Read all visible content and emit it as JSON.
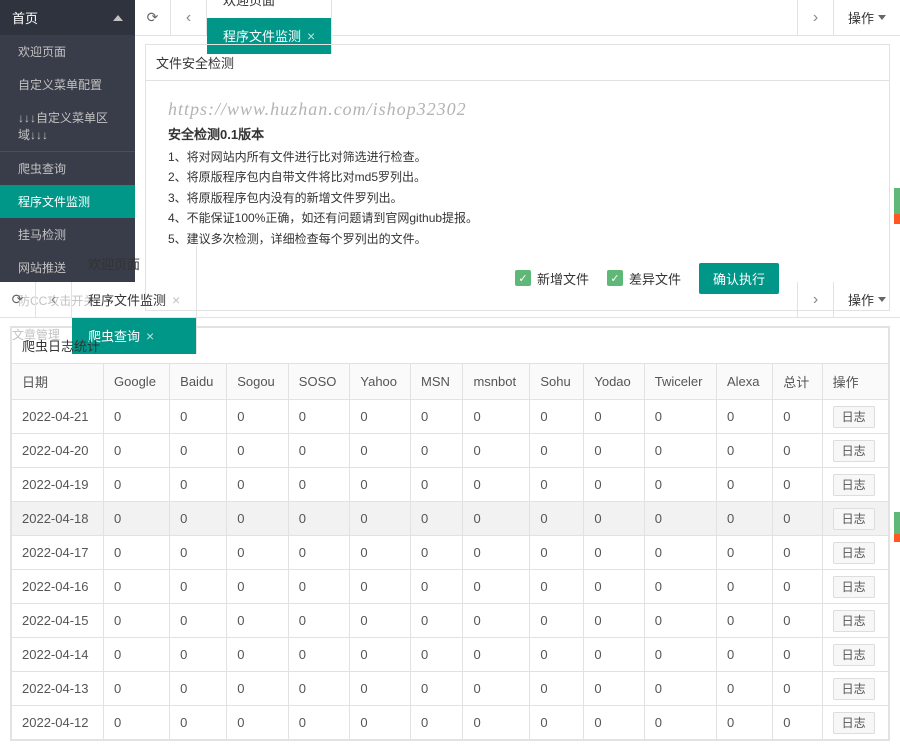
{
  "watermark": "https://www.huzhan.com/ishop32302",
  "top": {
    "sidebar": {
      "home": "首页",
      "items": [
        "欢迎页面",
        "自定义菜单配置",
        "↓↓↓自定义菜单区域↓↓↓",
        "爬虫查询",
        "程序文件监测",
        "挂马检测",
        "网站推送",
        "防CC攻击开关"
      ],
      "active_index": 4,
      "footer": "文章管理"
    },
    "tabs": {
      "items": [
        "欢迎页面",
        "程序文件监测"
      ],
      "active_index": 1,
      "ops": "操作"
    },
    "card": {
      "title": "文件安全检测",
      "section_title": "安全检测0.1版本",
      "lines": [
        "1、将对网站内所有文件进行比对筛选进行检查。",
        "2、将原版程序包内自带文件将比对md5罗列出。",
        "3、将原版程序包内没有的新增文件罗列出。",
        "4、不能保证100%正确，如还有问题请到官网github提报。",
        "5、建议多次检测，详细检查每个罗列出的文件。"
      ],
      "chk_new": "新增文件",
      "chk_diff": "差异文件",
      "exec": "确认执行"
    }
  },
  "bottom": {
    "tabs": {
      "items": [
        "欢迎页面",
        "程序文件监测",
        "爬虫查询"
      ],
      "active_index": 2,
      "ops": "操作"
    },
    "card_title": "爬虫日志统计",
    "headers": [
      "日期",
      "Google",
      "Baidu",
      "Sogou",
      "SOSO",
      "Yahoo",
      "MSN",
      "msnbot",
      "Sohu",
      "Yodao",
      "Twiceler",
      "Alexa",
      "总计",
      "操作"
    ],
    "log_label": "日志",
    "hl_index": 3,
    "rows": [
      {
        "date": "2022-04-21",
        "v": [
          "0",
          "0",
          "0",
          "0",
          "0",
          "0",
          "0",
          "0",
          "0",
          "0",
          "0",
          "0"
        ]
      },
      {
        "date": "2022-04-20",
        "v": [
          "0",
          "0",
          "0",
          "0",
          "0",
          "0",
          "0",
          "0",
          "0",
          "0",
          "0",
          "0"
        ]
      },
      {
        "date": "2022-04-19",
        "v": [
          "0",
          "0",
          "0",
          "0",
          "0",
          "0",
          "0",
          "0",
          "0",
          "0",
          "0",
          "0"
        ]
      },
      {
        "date": "2022-04-18",
        "v": [
          "0",
          "0",
          "0",
          "0",
          "0",
          "0",
          "0",
          "0",
          "0",
          "0",
          "0",
          "0"
        ]
      },
      {
        "date": "2022-04-17",
        "v": [
          "0",
          "0",
          "0",
          "0",
          "0",
          "0",
          "0",
          "0",
          "0",
          "0",
          "0",
          "0"
        ]
      },
      {
        "date": "2022-04-16",
        "v": [
          "0",
          "0",
          "0",
          "0",
          "0",
          "0",
          "0",
          "0",
          "0",
          "0",
          "0",
          "0"
        ]
      },
      {
        "date": "2022-04-15",
        "v": [
          "0",
          "0",
          "0",
          "0",
          "0",
          "0",
          "0",
          "0",
          "0",
          "0",
          "0",
          "0"
        ]
      },
      {
        "date": "2022-04-14",
        "v": [
          "0",
          "0",
          "0",
          "0",
          "0",
          "0",
          "0",
          "0",
          "0",
          "0",
          "0",
          "0"
        ]
      },
      {
        "date": "2022-04-13",
        "v": [
          "0",
          "0",
          "0",
          "0",
          "0",
          "0",
          "0",
          "0",
          "0",
          "0",
          "0",
          "0"
        ]
      },
      {
        "date": "2022-04-12",
        "v": [
          "0",
          "0",
          "0",
          "0",
          "0",
          "0",
          "0",
          "0",
          "0",
          "0",
          "0",
          "0"
        ]
      }
    ]
  }
}
